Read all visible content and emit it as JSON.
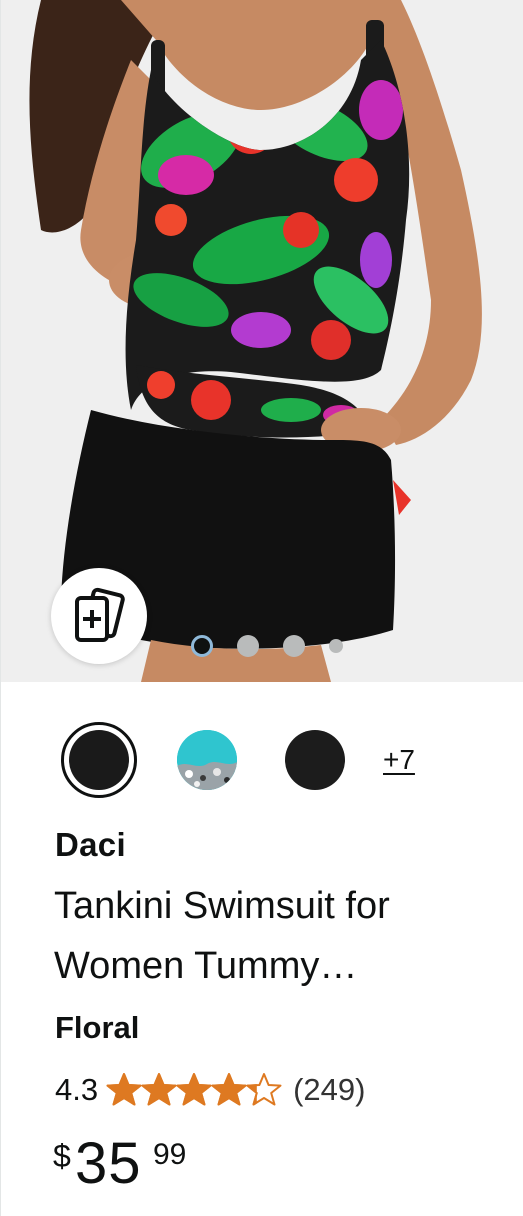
{
  "product": {
    "brand": "Daci",
    "title": "Tankini Swimsuit for Women Tummy…",
    "variant": "Floral",
    "rating": "4.3",
    "rating_value": 4.3,
    "rating_max": 5,
    "review_count": "(249)",
    "price": {
      "symbol": "$",
      "whole": "35",
      "fraction": "99"
    }
  },
  "gallery": {
    "image_count_dots": 4,
    "active_index": 0,
    "compare_icon": "compare-cards-icon"
  },
  "swatches": {
    "items": [
      {
        "color": "#1a1a1a",
        "selected": true
      },
      {
        "color": "#2fc5cf",
        "selected": false
      },
      {
        "color": "#1c1c1c",
        "selected": false
      }
    ],
    "more_label": "+7"
  },
  "colors": {
    "star": "#de7921",
    "text": "#0f1111"
  }
}
